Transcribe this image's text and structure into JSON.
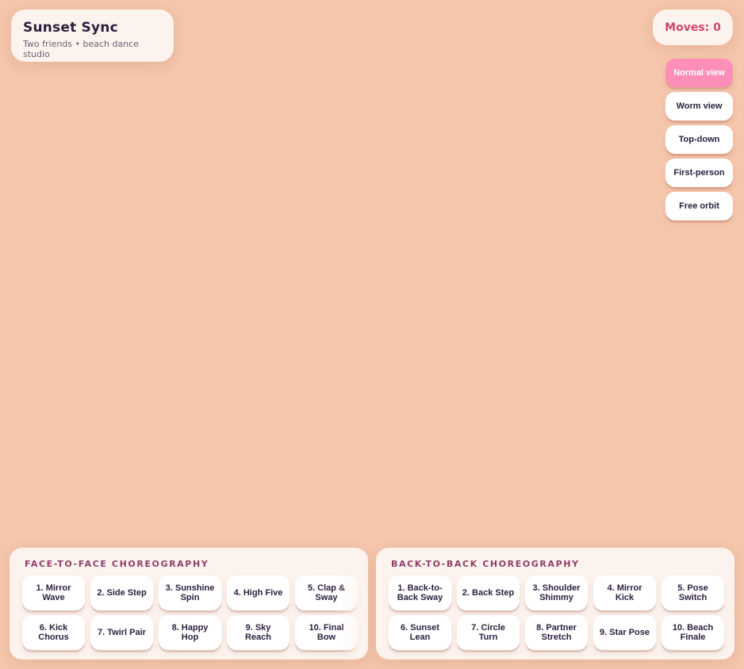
{
  "header": {
    "title": "Sunset Sync",
    "subtitle": "Two friends • beach dance studio"
  },
  "moves_counter": "Moves: 0",
  "views": [
    {
      "label": "Normal view",
      "active": true
    },
    {
      "label": "Worm view",
      "active": false
    },
    {
      "label": "Top-down",
      "active": false
    },
    {
      "label": "First-person",
      "active": false
    },
    {
      "label": "Free orbit",
      "active": false
    }
  ],
  "face_to_face": {
    "heading": "FACE-TO-FACE CHOREOGRAPHY",
    "moves": [
      "1. Mirror Wave",
      "2. Side Step",
      "3. Sunshine Spin",
      "4. High Five",
      "5. Clap & Sway",
      "6. Kick Chorus",
      "7. Twirl Pair",
      "8. Happy Hop",
      "9. Sky Reach",
      "10. Final Bow"
    ]
  },
  "back_to_back": {
    "heading": "BACK-TO-BACK CHOREOGRAPHY",
    "moves": [
      "1. Back-to-Back Sway",
      "2. Back Step",
      "3. Shoulder Shimmy",
      "4. Mirror Kick",
      "5. Pose Switch",
      "6. Sunset Lean",
      "7. Circle Turn",
      "8. Partner Stretch",
      "9. Star Pose",
      "10. Beach Finale"
    ]
  },
  "colors": {
    "background": "#f4c6ab",
    "accent": "#ff8fb8",
    "counter": "#d0456e",
    "heading": "#8e3f6a"
  }
}
